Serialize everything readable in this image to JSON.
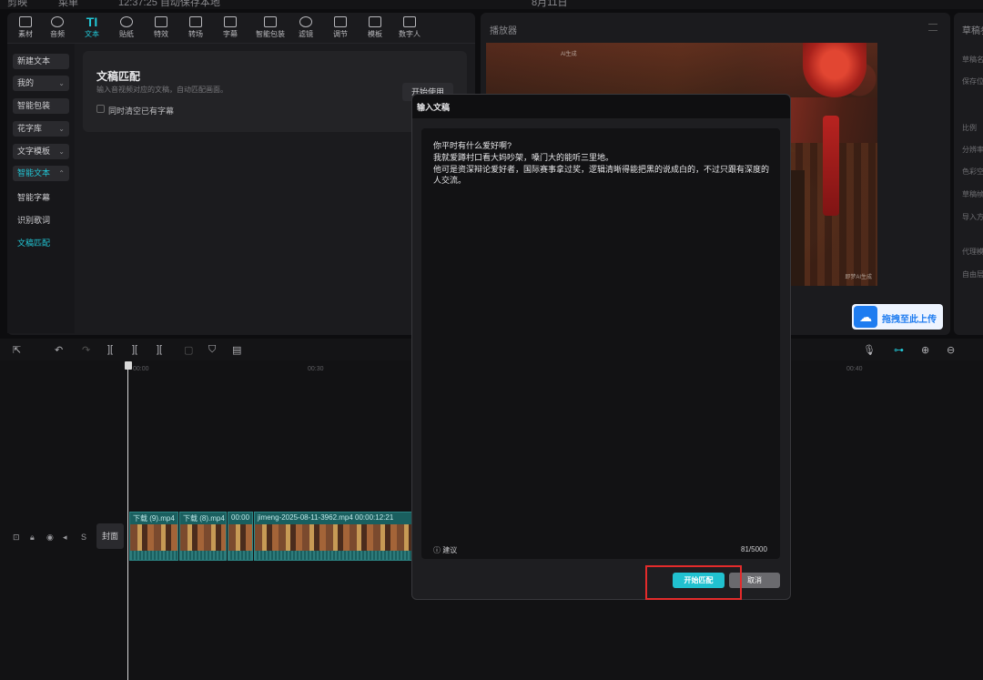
{
  "topbar": {
    "app_name": "剪映",
    "layout_label": "菜单",
    "autosave": "12:37:25 自动保存本地",
    "draft_title": "8月11日"
  },
  "category_tabs": [
    {
      "label": "素材"
    },
    {
      "label": "音频"
    },
    {
      "label": "文本",
      "active": true
    },
    {
      "label": "贴纸"
    },
    {
      "label": "特效"
    },
    {
      "label": "转场"
    },
    {
      "label": "字幕"
    },
    {
      "label": "智能包装"
    },
    {
      "label": "滤镜"
    },
    {
      "label": "调节"
    },
    {
      "label": "模板"
    },
    {
      "label": "数字人"
    }
  ],
  "sub_nav": {
    "new_text": "新建文本",
    "mine": "我的",
    "smart_pack": "智能包装",
    "flower_font": "花字库",
    "text_template": "文字模板",
    "smart_text": "智能文本",
    "smart_subtitle": "智能字幕",
    "lyrics": "识别歌词",
    "script_match": "文稿匹配"
  },
  "script_card": {
    "title": "文稿匹配",
    "subtitle": "输入音视频对应的文稿，自动匹配画面。",
    "checkbox_label": "同时清空已有字幕",
    "start_button": "开始使用"
  },
  "player": {
    "title": "播放器",
    "watermark_top": "AI生成",
    "watermark_bottom": "即梦AI生成"
  },
  "upload": {
    "label": "拖拽至此上传",
    "icon": "cloud-upload-icon"
  },
  "right_panel": {
    "title": "草稿参数",
    "labels": [
      "草稿名",
      "保存位",
      "比例",
      "分辨率",
      "色彩空",
      "草稿帧",
      "导入方",
      "代理模",
      "自由层"
    ]
  },
  "timeline": {
    "ruler_ticks": [
      "00:00",
      "00:30",
      "00:40"
    ],
    "cover_label": "封面",
    "clips": [
      {
        "label": "下载 (9).mp4"
      },
      {
        "label": "下载 (8).mp4  00:0"
      },
      {
        "label": "00:00"
      },
      {
        "label": "jimeng-2025-08-11-3962.mp4  00:00:12:21"
      }
    ]
  },
  "modal": {
    "title": "输入文稿",
    "lines": [
      "你平时有什么爱好啊?",
      "我就爱蹲村口看大妈吵架，嗓门大的能听三里地。",
      "他可是资深辩论爱好者，国际赛事拿过奖，逻辑清晰得能把黑的说成白的，不过只跟有深度的人交流。"
    ],
    "suggest_label": "建议",
    "counter": "81/5000",
    "start_button": "开始匹配",
    "cancel_button": "取消"
  },
  "colors": {
    "accent": "#21c1cf",
    "highlight_box": "#e42b2b",
    "upload_blue": "#1e7cf0"
  }
}
